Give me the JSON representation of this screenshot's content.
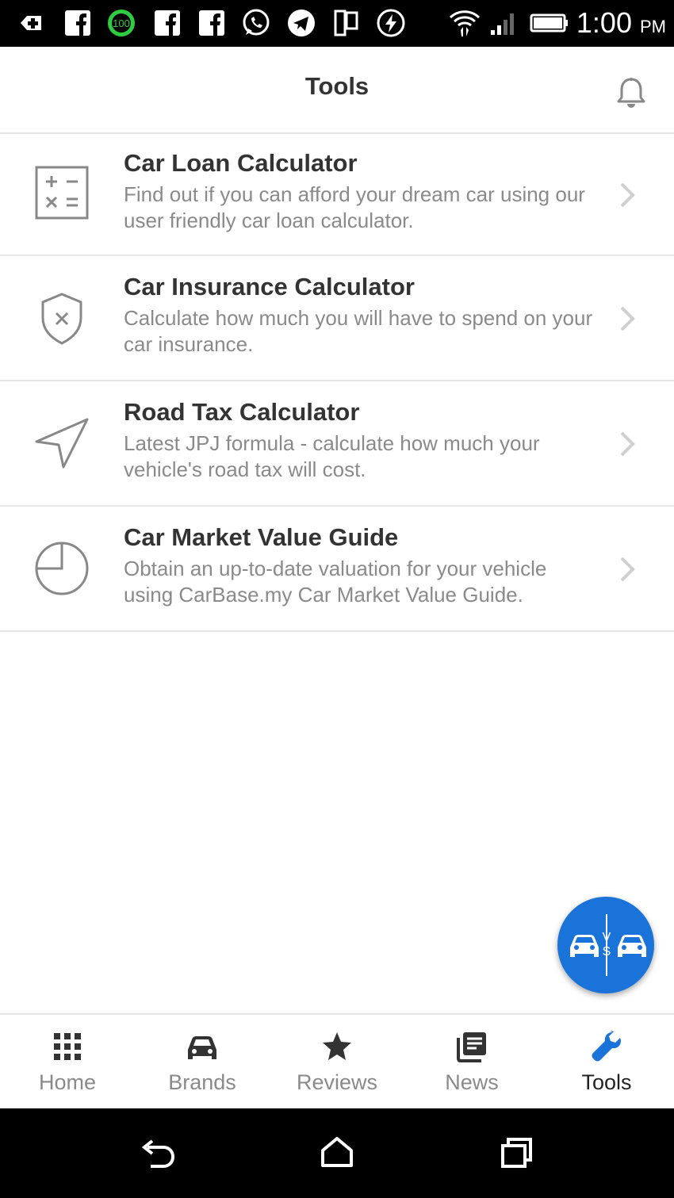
{
  "status_bar": {
    "time": "1:00",
    "ampm": "PM",
    "battery_badge": "100"
  },
  "header": {
    "title": "Tools",
    "notification_icon": "bell-icon"
  },
  "tools": [
    {
      "title": "Car Loan Calculator",
      "description": "Find out if you can afford your dream car using our user friendly car loan calculator.",
      "icon": "calculator-icon"
    },
    {
      "title": "Car Insurance Calculator",
      "description": "Calculate how much you will have to spend on your car insurance.",
      "icon": "shield-icon"
    },
    {
      "title": "Road Tax Calculator",
      "description": "Latest JPJ formula - calculate how much your vehicle's road tax will cost.",
      "icon": "navigation-arrow-icon"
    },
    {
      "title": "Car Market Value Guide",
      "description": "Obtain an up-to-date valuation for your vehicle using CarBase.my Car Market Value Guide.",
      "icon": "pie-chart-icon"
    }
  ],
  "fab": {
    "label_top": "V",
    "label_bottom": "S",
    "icon": "compare-cars-icon",
    "color": "#1a73d9"
  },
  "bottom_nav": {
    "items": [
      {
        "label": "Home",
        "icon": "grid-icon"
      },
      {
        "label": "Brands",
        "icon": "car-icon"
      },
      {
        "label": "Reviews",
        "icon": "star-icon"
      },
      {
        "label": "News",
        "icon": "news-icon"
      },
      {
        "label": "Tools",
        "icon": "wrench-icon",
        "active": true
      }
    ],
    "active_color": "#1a73d9"
  }
}
